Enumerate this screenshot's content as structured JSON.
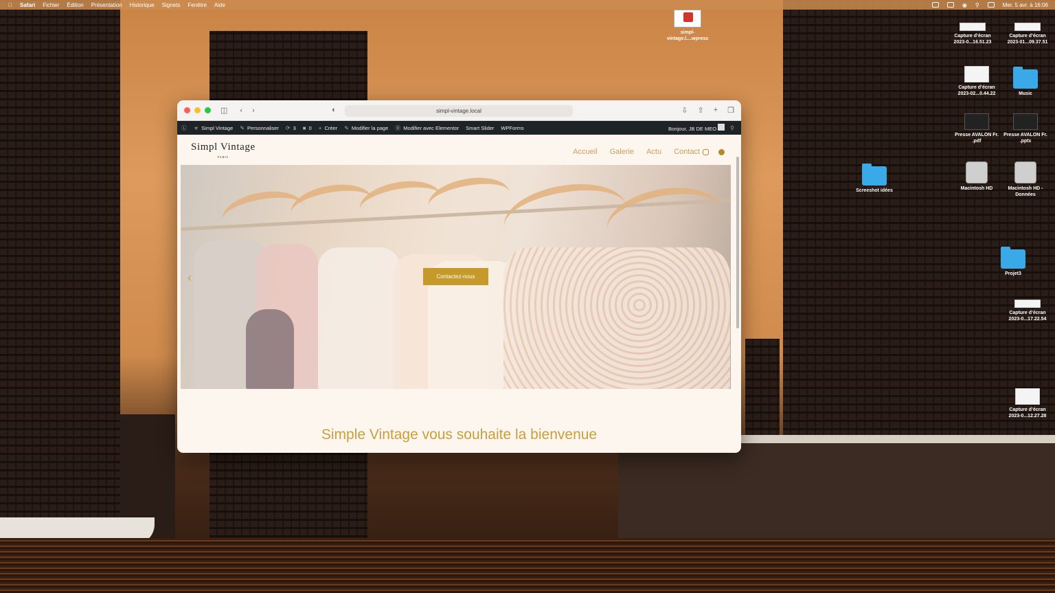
{
  "menubar": {
    "items": [
      "Safari",
      "Fichier",
      "Édition",
      "Présentation",
      "Historique",
      "Signets",
      "Fenêtre",
      "Aide"
    ],
    "datetime": "Mer. 5 avr. à 16:06"
  },
  "desktop": {
    "icons": [
      {
        "label": "simpl-vintage.l....wpress",
        "kind": "pdf"
      },
      {
        "label": "Capture d’écran 2023-0...16.51.23",
        "kind": "doc-wide"
      },
      {
        "label": "Capture d’écran 2023-01...09.37.51",
        "kind": "doc-wide"
      },
      {
        "label": "Capture d’écran 2023-02...0.44.22",
        "kind": "doc"
      },
      {
        "label": "Music",
        "kind": "folder"
      },
      {
        "label": "Presse AVALON Fr. .pdf",
        "kind": "doc-dark"
      },
      {
        "label": "Presse AVALON Fr. .pptx",
        "kind": "doc-dark"
      },
      {
        "label": "Screeshot idées",
        "kind": "folder"
      },
      {
        "label": "Macintosh HD",
        "kind": "disk"
      },
      {
        "label": "Macintosh HD - Données",
        "kind": "disk"
      },
      {
        "label": "Projet3",
        "kind": "folder"
      },
      {
        "label": "Capture d’écran 2023-0...17.22.54",
        "kind": "doc-wide"
      },
      {
        "label": "Capture d’écran 2023-0...12.27.28",
        "kind": "doc"
      }
    ]
  },
  "browser": {
    "url": "simpl-vintage.local"
  },
  "adminbar": {
    "site_name": "Simpl Vintage",
    "customize": "Personnaliser",
    "updates_count": "3",
    "comments_count": "0",
    "new": "Créer",
    "edit_page": "Modifier la page",
    "edit_elementor": "Modifier avec Elementor",
    "smart_slider": "Smart Slider",
    "wpforms": "WPForms",
    "greeting": "Bonjour, JB DE MEO"
  },
  "site": {
    "logo_name": "Simpl Vintage",
    "logo_sub": "PARIS",
    "nav": [
      "Accueil",
      "Galerie",
      "Actu",
      "Contact"
    ],
    "cta": "Contactez-nous",
    "welcome": "Simple Vintage vous souhaite la bienvenue"
  },
  "colors": {
    "accent_gold": "#c59a2a",
    "nav_gold": "#c99f5a",
    "site_bg": "#fdf6ee",
    "adminbar_bg": "#1d2327"
  }
}
